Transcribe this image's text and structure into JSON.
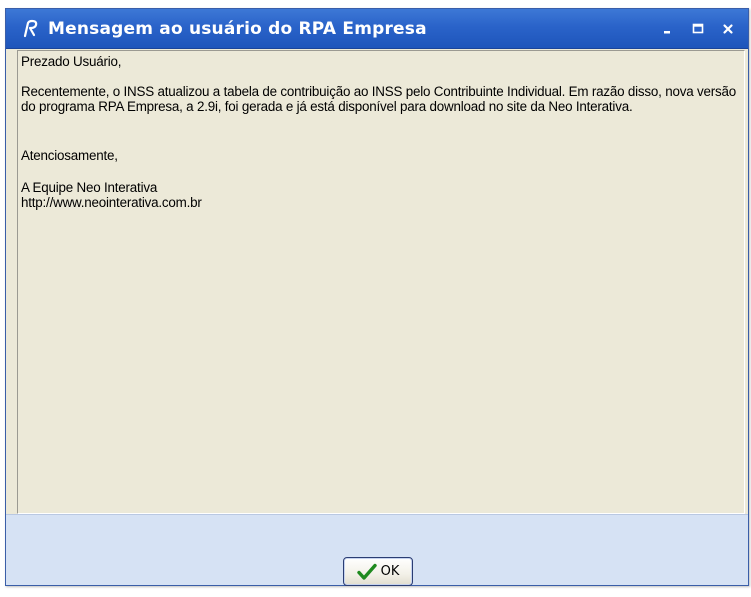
{
  "window": {
    "title": "Mensagem ao usuário do RPA Empresa",
    "controls": {
      "minimize": "-",
      "maximize": "□",
      "close": "×"
    }
  },
  "message": {
    "greeting": "Prezado Usuário,",
    "body": "Recentemente, o INSS atualizou a tabela de contribuição ao INSS pelo Contribuinte Individual. Em razão disso, nova versão do programa RPA Empresa, a 2.9i, foi gerada e já está disponível para download no site da Neo Interativa.",
    "closing": "Atenciosamente,",
    "signature_team": "A Equipe Neo Interativa",
    "signature_url": "http://www.neointerativa.com.br"
  },
  "footer": {
    "ok_label": "OK"
  },
  "colors": {
    "titlebar": "#2a63c9",
    "window_bg": "#ece9d8",
    "footer_bg": "#d6e2f4",
    "check_green": "#1f8a1f"
  },
  "icons": {
    "app": "rpa-logo-icon",
    "ok": "checkmark-icon"
  }
}
